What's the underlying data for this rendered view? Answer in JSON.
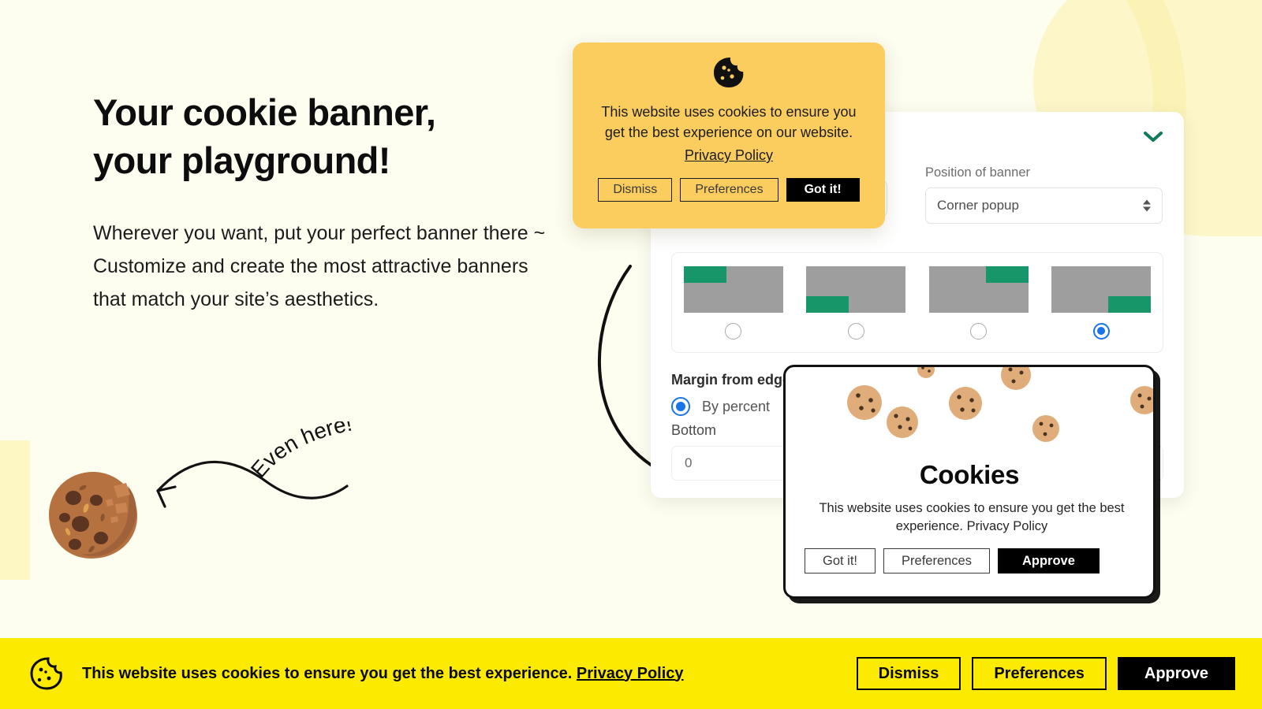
{
  "theme": {
    "page_bg": "#fdfdf0",
    "accent_yellow": "#fcea00",
    "popup_yellow": "#fbcd5f",
    "soft_yellow": "#fbf3b6",
    "teal": "#179669",
    "blue": "#1a73e8",
    "grey": "#9e9e9e",
    "black": "#0b0b0b"
  },
  "hero": {
    "headline_line1": "Your cookie banner,",
    "headline_line2": "your playground!",
    "subcopy": "Wherever you want, put your perfect banner there ~  Customize and create the most attractive banners that match your site’s aesthetics.",
    "annotation": "Even here!",
    "cookie_illustration": "chocolate-chip-cookie-bitten"
  },
  "yellow_popup": {
    "icon": "cookie-bite-icon",
    "message": "This website uses cookies to ensure you get the best experience on our website.",
    "link": "Privacy Policy",
    "buttons": [
      {
        "label": "Dismiss",
        "style": "outline"
      },
      {
        "label": "Preferences",
        "style": "outline"
      },
      {
        "label": "Got it!",
        "style": "primary"
      }
    ]
  },
  "settings_card": {
    "collapse_icon": "chevron-down-icon",
    "fields": [
      {
        "label": "",
        "value": "",
        "name": "hidden-select"
      },
      {
        "label": "Position of banner",
        "value": "Corner popup",
        "name": "position-of-banner-select"
      }
    ],
    "position_options": [
      {
        "name": "top-left",
        "corner": "tl",
        "selected": false
      },
      {
        "name": "bottom-left",
        "corner": "bl",
        "selected": false
      },
      {
        "name": "top-right",
        "corner": "tr",
        "selected": false
      },
      {
        "name": "bottom-right",
        "corner": "br",
        "selected": true
      }
    ],
    "margin_title": "Margin from edges",
    "by_percent_label": "By percent",
    "by_percent_selected": true,
    "bottom_label": "Bottom",
    "bottom_value": "0"
  },
  "white_popup": {
    "title": "Cookies",
    "message": "This website uses cookies to ensure you get the best experience. Privacy Policy",
    "buttons": [
      {
        "label": "Got it!",
        "style": "outline"
      },
      {
        "label": "Preferences",
        "style": "outline"
      },
      {
        "label": "Approve",
        "style": "primary"
      }
    ],
    "decoration": "scattered-cookies"
  },
  "bottom_bar": {
    "icon": "cookie-bite-icon",
    "message": "This website uses cookies to ensure you get the best experience.",
    "link": "Privacy Policy",
    "buttons": [
      {
        "label": "Dismiss",
        "style": "outline"
      },
      {
        "label": "Preferences",
        "style": "outline"
      },
      {
        "label": "Approve",
        "style": "primary"
      }
    ]
  }
}
